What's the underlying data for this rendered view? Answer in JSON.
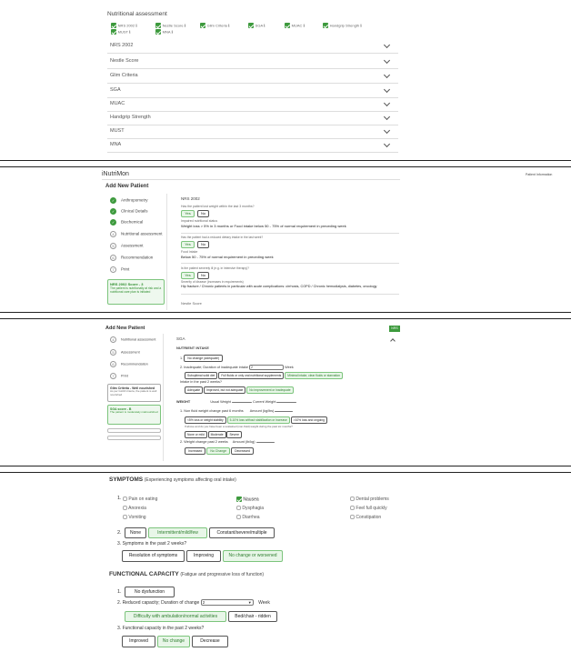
{
  "nutritional": {
    "title": "Nutritional assessment",
    "checks_row1": [
      "NRS 2002 ℹ",
      "Nestle Score ℹ",
      "Glim Criteria ℹ",
      "SGA ℹ",
      "MUAC ℹ",
      "Handgrip Strength ℹ"
    ],
    "checks_row2": [
      "MUST ℹ",
      "MNA ℹ"
    ],
    "accordion": [
      "NRS 2002",
      "Nestle Score",
      "Glim Criteria",
      "SGA",
      "MUAC",
      "Handgrip Strength",
      "MUST",
      "MNA"
    ]
  },
  "add_patient": {
    "brand": "iNutriMon",
    "brand_right": "Patient Information",
    "title": "Add New Patient",
    "steps": [
      "Anthropometry",
      "Clinical Details",
      "Biochemical",
      "Nutritional assessment",
      "Assessment",
      "Recommendation",
      "Print"
    ],
    "score_box": "NRS 2002 Score - 3",
    "score_desc": "The patient is nutritionally at risk and a nutritional care plan is initiated",
    "section": "NRS 2002",
    "q1": "Has the patient lost weight within the last 3 months?",
    "q1_sub": "Impaired nutritional status",
    "q1_answer": "Weight loss > 5% in 3 months or Food intake below 50 - 75% of normal requirement in preceding week",
    "q2": "Has the patient had a reduced dietary intake in the last week?",
    "q2_sub": "Food intake",
    "q2_answer": "Below 50 - 75% of normal requirement in preceding week",
    "q3": "Is the patient severely ill (e.g. in intensive therapy)?",
    "q3_sub": "Severity of disease (increases in requirements)",
    "q3_answer": "Hip fracture / Chronic patients in particular with acute complications: cirrhosis, COPD / Chronic hemodialysis, diabetes, oncology",
    "yes": "Yes",
    "no": "No",
    "footer": "Nestle Score"
  },
  "sga": {
    "title": "Add New Patient",
    "green_tab": "NRS",
    "steps": [
      "Nutritional assessment",
      "Assessment",
      "Recommendation",
      "Print"
    ],
    "glim_title": "Glim Criteria - Well nourished",
    "glim_desc": "As per GLIM criteria, the patient is well nourished",
    "sga_score_title": "SGA score - B",
    "sga_score_desc": "The patient is moderately malnourished",
    "section": "SGA",
    "subsection": "NUTRIENT INTAKE",
    "row1": "No change (adequate)",
    "row2_label": "Inadequate; Duration of inadequate intake",
    "row2_value": "2",
    "row2_unit": "Week",
    "row2_opts": [
      "Suboptimal solid diet",
      "Full fluids or only oral nutritional supplements",
      "Minimal intake, clear fluids or starvation"
    ],
    "row3_label": "Intake in the past 2 weeks?",
    "row3_opts": [
      "Adequate",
      "Improved, but not adequate",
      "No improvement or inadequate"
    ],
    "weight_label": "WEIGHT",
    "usual_weight": "Usual Weight",
    "current_weight": "Current Weight",
    "row4_label": "Non fluid weight change past 6 months",
    "row4_amount": "Amount (kg/lbs)",
    "row4_opts": [
      "<5% loss or weight stability",
      "5-10% loss without stabilization or increase",
      ">10% loss and ongoing"
    ],
    "row4_note": "If above and do you have been a sustained (non-fluid) weight during the past six months?",
    "row4_opts2": [
      "None or mild",
      "Moderate",
      "Severe"
    ],
    "row5_label": "Weight change past 2 weeks",
    "row5_amount": "Amount (lb/kg)",
    "row5_opts": [
      "Increased",
      "No Change",
      "Decreased"
    ]
  },
  "symptoms": {
    "title": "SYMPTOMS",
    "subtitle": "(Experiencing symptoms affecting oral intake)",
    "col1": [
      "Pain on eating",
      "Anorexia",
      "Vomiting"
    ],
    "col2": [
      "Nausea",
      "Dysphagia",
      "Diarrhea"
    ],
    "col3": [
      "Dental problems",
      "Feel full quickly",
      "Constipation"
    ],
    "severity": [
      "None",
      "Intermittent/mild/few",
      "Constant/severe/multiple"
    ],
    "past_label": "Symptoms in the past 2 weeks?",
    "past_opts": [
      "Resolution of symptoms",
      "Improving",
      "No change or worsened"
    ]
  },
  "functional": {
    "title": "FUNCTIONAL CAPACITY",
    "subtitle": "(Fatigue and progressive loss of function)",
    "opt1": "No dysfunction",
    "reduced_label": "Reduced capacity; Duration of change",
    "reduced_value": "2",
    "reduced_unit": "Week",
    "reduced_opts": [
      "Difficulty with ambulation/normal activities",
      "Bed/chair - ridden"
    ],
    "past_label": "Functional capacity in the past 2 weeks?",
    "past_opts": [
      "Improved",
      "No change",
      "Decrease"
    ]
  }
}
